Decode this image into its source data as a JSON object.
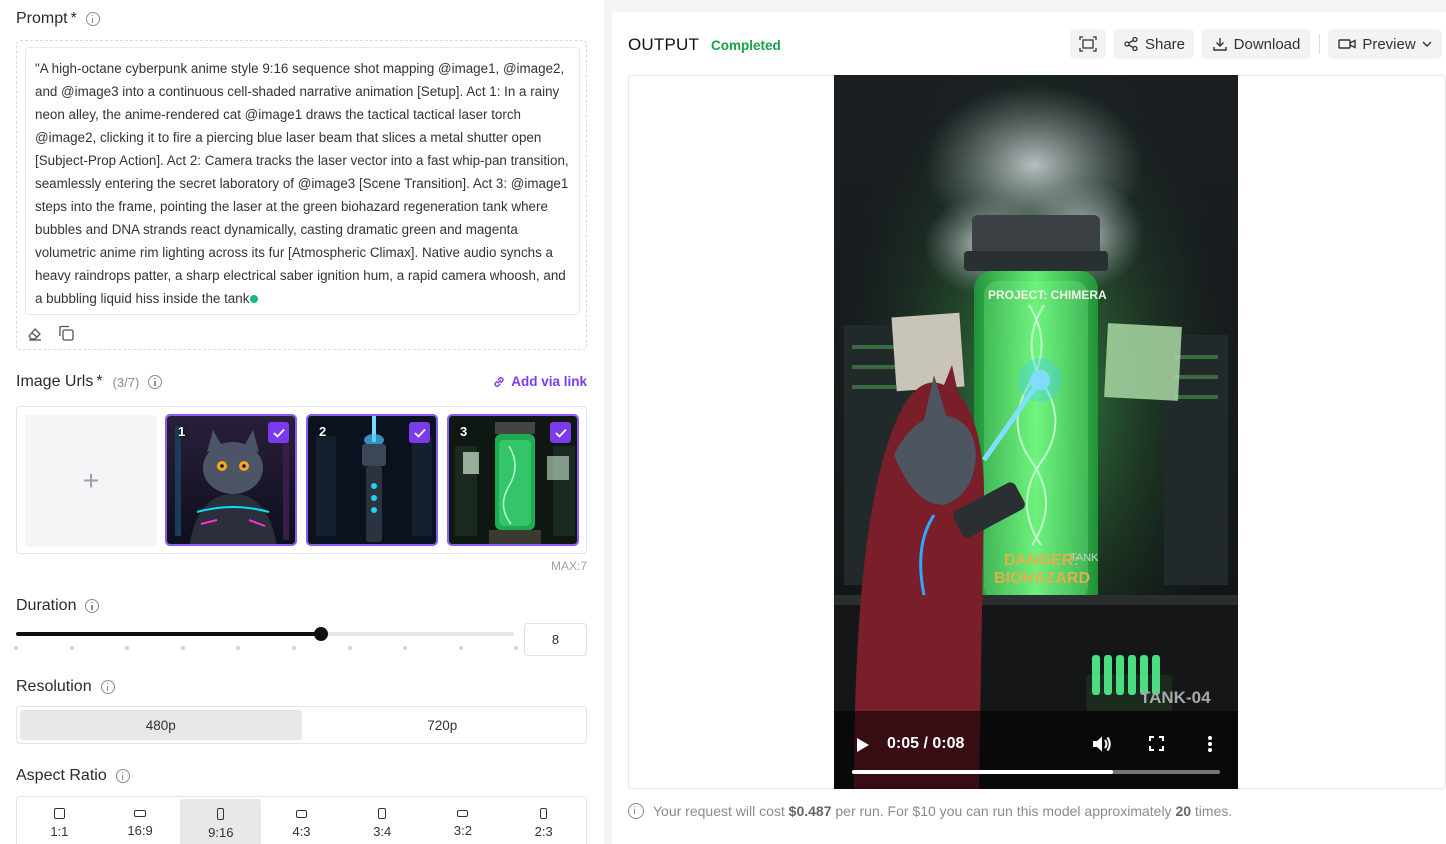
{
  "prompt": {
    "label": "Prompt",
    "required_mark": "*",
    "text": "\"A high-octane cyberpunk anime style 9:16 sequence shot mapping @image1, @image2, and @image3 into a continuous cell-shaded narrative animation [Setup]. Act 1: In a rainy neon alley, the anime-rendered cat @image1 draws the tactical tactical laser torch @image2, clicking it to fire a piercing blue laser beam that slices a metal shutter open [Subject-Prop Action]. Act 2: Camera tracks the laser vector into a fast whip-pan transition, seamlessly entering the secret laboratory of @image3 [Scene Transition]. Act 3: @image1 steps into the frame, pointing the laser at the green biohazard regeneration tank where bubbles and DNA strands react dynamically, casting dramatic green and magenta volumetric anime rim lighting across its fur [Atmospheric Climax]. Native audio synchs a heavy raindrops patter, a sharp electrical saber ignition hum, a rapid camera whoosh, and a bubbling liquid hiss inside the tank"
  },
  "image_urls": {
    "label": "Image Urls",
    "required_mark": "*",
    "count": "(3/7)",
    "add_link": "Add via link",
    "max": "MAX:7",
    "upload_symbol": "+",
    "images": [
      {
        "num": "1",
        "icon": "cat-astronaut-image"
      },
      {
        "num": "2",
        "icon": "laser-torch-image"
      },
      {
        "num": "3",
        "icon": "lab-tank-image"
      }
    ]
  },
  "duration": {
    "label": "Duration",
    "value": "8",
    "min": 1,
    "max": 10
  },
  "resolution": {
    "label": "Resolution",
    "options": [
      "480p",
      "720p"
    ],
    "selected": "480p"
  },
  "aspect_ratio": {
    "label": "Aspect Ratio",
    "options": [
      "1:1",
      "16:9",
      "9:16",
      "4:3",
      "3:4",
      "3:2",
      "2:3"
    ],
    "selected": "9:16"
  },
  "output": {
    "title": "OUTPUT",
    "status": "Completed",
    "share_label": "Share",
    "download_label": "Download",
    "preview_label": "Preview"
  },
  "video": {
    "time": "0:05 / 0:08",
    "progress": 0.71,
    "texts": {
      "project": "PROJECT: CHIMERA",
      "danger1": "DANGER:",
      "danger2": "BIOHAZARD",
      "tank_small": "TANK",
      "tank_id": "TANK-04"
    }
  },
  "cost": {
    "prefix": "Your request will cost",
    "amount": "$0.487",
    "middle": "per run. For $10 you can run this model approximately",
    "times": "20",
    "suffix": "times."
  },
  "colors": {
    "accent": "#7c3aed",
    "success": "#16a34a",
    "dot": "#10b981"
  }
}
